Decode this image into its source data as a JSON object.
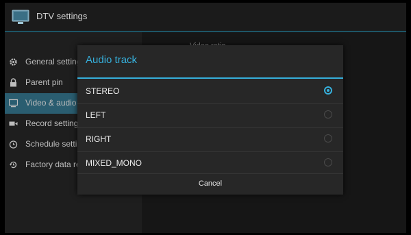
{
  "app": {
    "title": "DTV settings",
    "icon": "tv-icon"
  },
  "sidebar": {
    "items": [
      {
        "label": "General settings",
        "icon": "gear-icon",
        "active": false
      },
      {
        "label": "Parent pin",
        "icon": "lock-icon",
        "active": false
      },
      {
        "label": "Video & audio",
        "icon": "monitor-icon",
        "active": true
      },
      {
        "label": "Record settings",
        "icon": "video-camera-icon",
        "active": false
      },
      {
        "label": "Schedule settings",
        "icon": "clock-icon",
        "active": false
      },
      {
        "label": "Factory data reset",
        "icon": "restore-icon",
        "active": false
      }
    ]
  },
  "content": {
    "header": "Video ratio"
  },
  "dialog": {
    "title": "Audio track",
    "options": [
      {
        "label": "STEREO",
        "selected": true
      },
      {
        "label": "LEFT",
        "selected": false
      },
      {
        "label": "RIGHT",
        "selected": false
      },
      {
        "label": "MIXED_MONO",
        "selected": false
      }
    ],
    "cancel_label": "Cancel"
  },
  "colors": {
    "accent": "#36b0dc",
    "active_row": "#2a5d70",
    "dialog_bg": "#272727"
  }
}
